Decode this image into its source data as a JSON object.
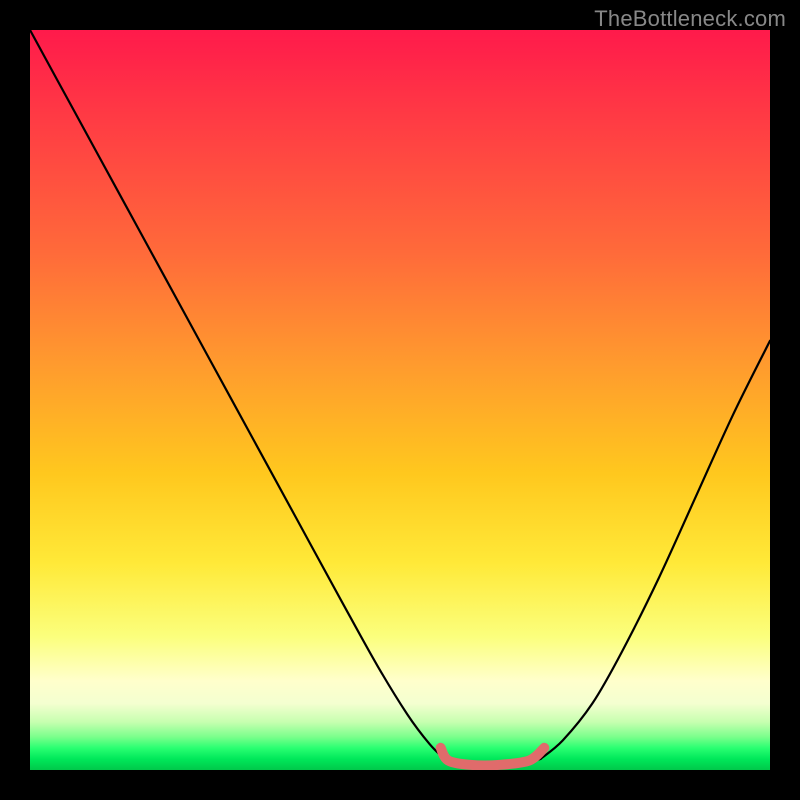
{
  "watermark": "TheBottleneck.com",
  "colors": {
    "background": "#000000",
    "gradient_stops": [
      "#ff1a4b",
      "#ff3b44",
      "#ff6a3a",
      "#ff9a2e",
      "#ffc81e",
      "#ffe938",
      "#fbff7d",
      "#ffffcc",
      "#f4ffd0",
      "#c7ffb0",
      "#7cff8c",
      "#2bff72",
      "#00e85a",
      "#00c84a"
    ],
    "curve": "#000000",
    "highlight": "#e06b6b"
  },
  "chart_data": {
    "type": "line",
    "title": "",
    "xlabel": "",
    "ylabel": "",
    "xlim": [
      0,
      1
    ],
    "ylim": [
      0,
      1
    ],
    "series": [
      {
        "name": "left-branch",
        "x": [
          0.0,
          0.06,
          0.12,
          0.18,
          0.24,
          0.3,
          0.36,
          0.42,
          0.47,
          0.51,
          0.54,
          0.56
        ],
        "y": [
          1.0,
          0.89,
          0.78,
          0.67,
          0.56,
          0.45,
          0.34,
          0.23,
          0.14,
          0.075,
          0.035,
          0.015
        ]
      },
      {
        "name": "valley-floor",
        "x": [
          0.56,
          0.58,
          0.62,
          0.66,
          0.69
        ],
        "y": [
          0.015,
          0.008,
          0.006,
          0.008,
          0.015
        ]
      },
      {
        "name": "right-branch",
        "x": [
          0.69,
          0.72,
          0.76,
          0.8,
          0.85,
          0.9,
          0.95,
          1.0
        ],
        "y": [
          0.015,
          0.04,
          0.09,
          0.16,
          0.26,
          0.37,
          0.48,
          0.58
        ]
      },
      {
        "name": "valley-highlight",
        "x": [
          0.555,
          0.565,
          0.595,
          0.635,
          0.675,
          0.695
        ],
        "y": [
          0.03,
          0.013,
          0.007,
          0.007,
          0.013,
          0.03
        ]
      }
    ]
  }
}
